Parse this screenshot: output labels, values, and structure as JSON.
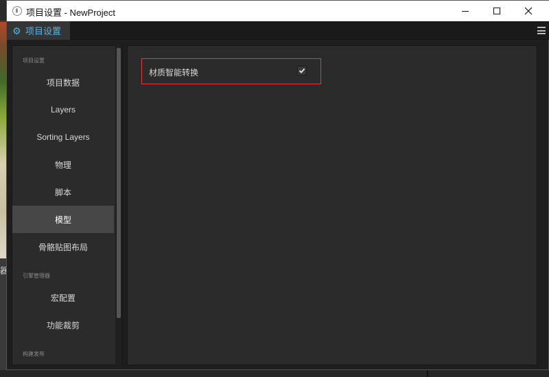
{
  "background": {
    "fragment_text": "器"
  },
  "window": {
    "title": "项目设置 - NewProject"
  },
  "tab": {
    "label": "项目设置"
  },
  "sidebar": {
    "sections": [
      {
        "title": "项目设置",
        "items": [
          "项目数据",
          "Layers",
          "Sorting Layers",
          "物理",
          "脚本",
          "模型",
          "骨骼贴图布局"
        ]
      },
      {
        "title": "引擎管理器",
        "items": [
          "宏配置",
          "功能裁剪"
        ]
      },
      {
        "title": "构建发布",
        "items": []
      }
    ],
    "active_item": "模型"
  },
  "main": {
    "option_label": "材质智能转换",
    "option_checked": true
  },
  "colors": {
    "accent": "#4fb4e8",
    "highlight_border": "#e03c3c",
    "active_item_bg": "#474747"
  }
}
